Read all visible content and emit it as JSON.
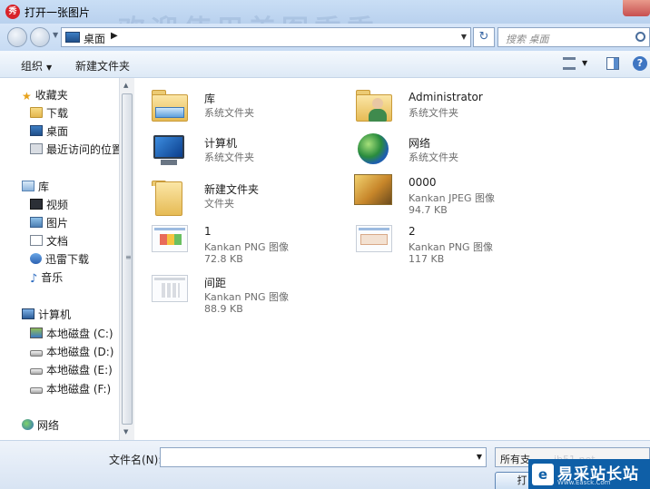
{
  "window": {
    "title": "打开一张图片",
    "app_icon_glyph": "秀",
    "title_watermark": "欢迎使用美图秀秀"
  },
  "address_bar": {
    "location": "桌面",
    "search_placeholder": "搜索 桌面"
  },
  "toolbar": {
    "organize": "组织",
    "new_folder": "新建文件夹"
  },
  "nav": {
    "favorites": {
      "label": "收藏夹",
      "items": [
        "下载",
        "桌面",
        "最近访问的位置"
      ]
    },
    "libraries": {
      "label": "库",
      "items": [
        "视频",
        "图片",
        "文档",
        "迅雷下载",
        "音乐"
      ]
    },
    "computer": {
      "label": "计算机",
      "drives": [
        "本地磁盘 (C:)",
        "本地磁盘 (D:)",
        "本地磁盘 (E:)",
        "本地磁盘 (F:)"
      ]
    },
    "network": {
      "label": "网络"
    }
  },
  "files": [
    {
      "name": "库",
      "type": "系统文件夹",
      "size": "",
      "icon": "library-icon"
    },
    {
      "name": "Administrator",
      "type": "系统文件夹",
      "size": "",
      "icon": "user-folder-icon"
    },
    {
      "name": "计算机",
      "type": "系统文件夹",
      "size": "",
      "icon": "computer-icon"
    },
    {
      "name": "网络",
      "type": "系统文件夹",
      "size": "",
      "icon": "network-icon"
    },
    {
      "name": "新建文件夹",
      "type": "文件夹",
      "size": "",
      "icon": "folder-icon"
    },
    {
      "name": "0000",
      "type": "Kankan JPEG 图像",
      "size": "94.7 KB",
      "icon": "jpeg-thumbnail"
    },
    {
      "name": "1",
      "type": "Kankan PNG 图像",
      "size": "72.8 KB",
      "icon": "png-thumbnail"
    },
    {
      "name": "2",
      "type": "Kankan PNG 图像",
      "size": "117 KB",
      "icon": "png-thumbnail"
    },
    {
      "name": "间距",
      "type": "Kankan PNG 图像",
      "size": "88.9 KB",
      "icon": "png-thumbnail"
    }
  ],
  "bottom": {
    "filename_label": "文件名(N):",
    "filename_value": "",
    "filetype_value": "所有支",
    "open_button": "打"
  },
  "watermark": {
    "badge": "e",
    "text": "易采站长站",
    "url": "Www.Easck.Com",
    "faint": "ib51.net"
  },
  "colors": {
    "title_bar": "#c9def5",
    "toolbar": "#dde9f6",
    "watermark_bg": "#0f5fa7"
  }
}
